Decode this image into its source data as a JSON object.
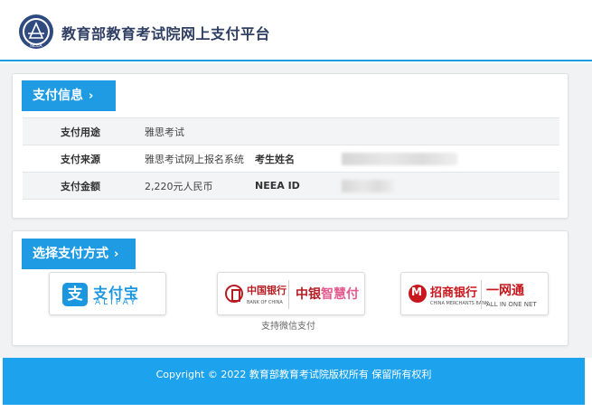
{
  "header": {
    "logo_text": "NEEA",
    "site_title": "教育部教育考试院网上支付平台"
  },
  "info_section": {
    "title": "支付信息",
    "chevron": "›",
    "rows": [
      {
        "label": "支付用途",
        "value": "雅思考试"
      },
      {
        "label": "支付来源",
        "value": "雅思考试网上报名系统",
        "label2": "考生姓名",
        "value2_redacted": true
      },
      {
        "label": "支付金额",
        "value": "2,220元人民币",
        "label2": "NEEA ID",
        "value2_redacted": true
      }
    ]
  },
  "pay_section": {
    "title": "选择支付方式",
    "chevron": "›",
    "options": {
      "alipay": {
        "icon": "alipay-icon",
        "cn": "支付宝",
        "en": "ALIPAY",
        "mark": "支"
      },
      "boc": {
        "icon": "boc-logo-icon",
        "cn": "中国银行",
        "en": "BANK OF CHINA",
        "brand_a": "中银",
        "brand_b": "智慧付"
      },
      "cmb": {
        "icon": "cmb-logo-icon",
        "cn": "招商银行",
        "en": "CHINA MERCHANTS BANK",
        "brand": "一网通",
        "sub": "ALL IN ONE NET"
      }
    },
    "wechat_note": "支持微信支付"
  },
  "footer": {
    "copyright": "Copyright © 2022 教育部教育考试院版权所有 保留所有权利"
  },
  "colors": {
    "accent": "#1e9be3",
    "footer_bg": "#1da2ee",
    "title_text": "#2f3e63",
    "boc_red": "#b81c22",
    "cmb_red": "#c8161d"
  }
}
